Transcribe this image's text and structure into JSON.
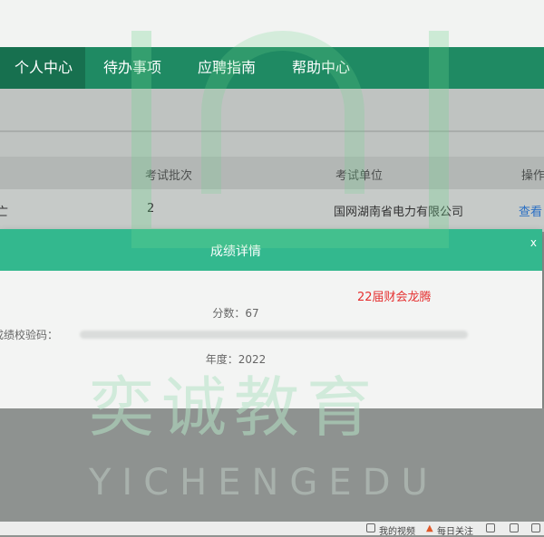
{
  "nav": {
    "items": [
      {
        "label": "个人中心",
        "active": true
      },
      {
        "label": "待办事项",
        "active": false
      },
      {
        "label": "应聘指南",
        "active": false
      },
      {
        "label": "帮助中心",
        "active": false
      }
    ]
  },
  "table": {
    "headers": [
      "考试批次",
      "考试单位",
      "操作"
    ],
    "row": {
      "prefix": "亡",
      "batch": "2",
      "unit": "国网湖南省电力有限公司",
      "action": "查看"
    }
  },
  "modal": {
    "title": "成绩详情",
    "close": "x",
    "annotation": "22届财会龙腾",
    "score": "分数：67",
    "code_label": "成绩校验码：",
    "year": "年度：2022"
  },
  "watermark": {
    "cn": "奕诚教育",
    "en": "YICHENGEDU"
  },
  "taskbar": {
    "items": [
      "我的视频",
      "每日关注"
    ]
  }
}
